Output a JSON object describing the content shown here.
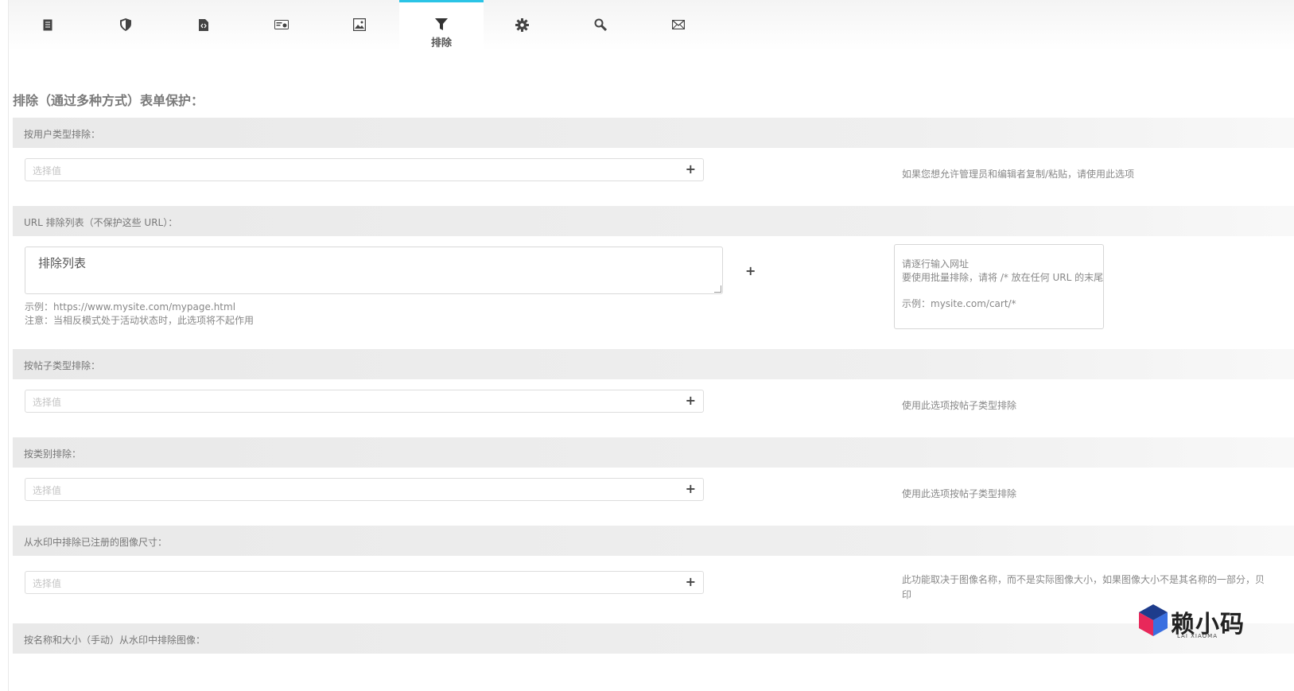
{
  "tabs": [
    {
      "name": "document",
      "icon": "document-icon",
      "label": ""
    },
    {
      "name": "shield",
      "icon": "shield-icon",
      "label": ""
    },
    {
      "name": "code-file",
      "icon": "code-file-icon",
      "label": ""
    },
    {
      "name": "id-card",
      "icon": "id-card-icon",
      "label": ""
    },
    {
      "name": "image",
      "icon": "image-icon",
      "label": ""
    },
    {
      "name": "exclude",
      "icon": "filter-icon",
      "label": "排除",
      "active": true
    },
    {
      "name": "settings",
      "icon": "gear-icon",
      "label": ""
    },
    {
      "name": "search",
      "icon": "search-icon",
      "label": ""
    },
    {
      "name": "mail",
      "icon": "mail-icon",
      "label": ""
    }
  ],
  "accent_color": "#2bc4e6",
  "page_title": "排除（通过多种方式）表单保护：",
  "sections": {
    "user_type": {
      "header": "按用户类型排除：",
      "placeholder": "选择值",
      "help": "如果您想允许管理员和编辑者复制/粘贴，请使用此选项"
    },
    "url_list": {
      "header": "URL 排除列表（不保护这些 URL）：",
      "textarea_value": "排除列表",
      "example": "示例：https://www.mysite.com/mypage.html",
      "notice": "注意：当相反模式处于活动状态时，此选项将不起作用",
      "hint_line1": "请逐行输入网址",
      "hint_line2": "要使用批量排除，请将 /* 放在任何 URL 的末尾",
      "hint_line3": "示例：mysite.com/cart/*"
    },
    "post_type": {
      "header": "按帖子类型排除：",
      "placeholder": "选择值",
      "help": "使用此选项按帖子类型排除"
    },
    "category": {
      "header": "按类别排除：",
      "placeholder": "选择值",
      "help": "使用此选项按帖子类型排除"
    },
    "image_sizes": {
      "header": "从水印中排除已注册的图像尺寸：",
      "placeholder": "选择值",
      "help_line1": "此功能取决于图像名称，而不是实际图像大小，如果图像大小不是其名称的一部分，贝",
      "help_line2": "印"
    },
    "name_size": {
      "header": "按名称和大小（手动）从水印中排除图像："
    }
  },
  "watermark": {
    "text": "赖小码",
    "sub": "LAI XIAOMA"
  }
}
